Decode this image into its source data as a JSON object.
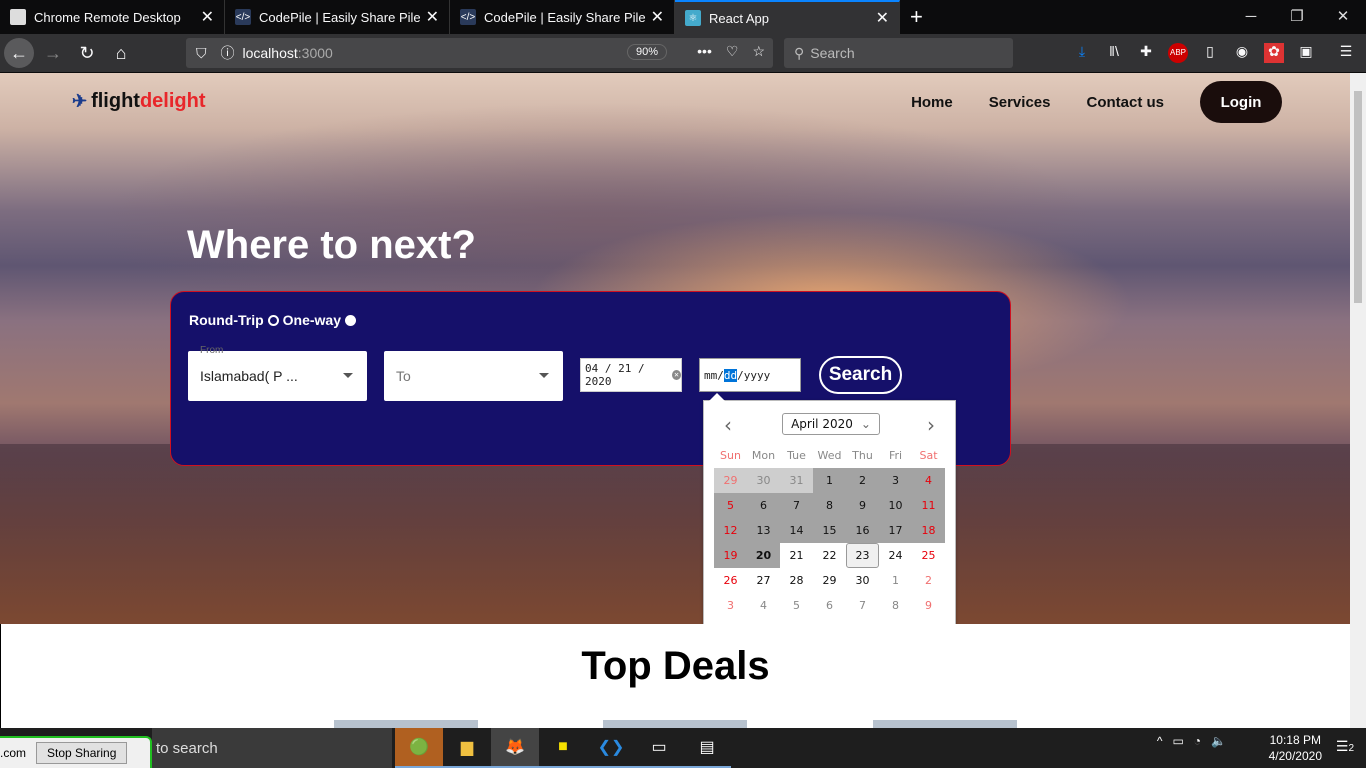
{
  "browser": {
    "tabs": [
      {
        "title": "Chrome Remote Desktop",
        "icon": "remote-desktop-icon"
      },
      {
        "title": "CodePile | Easily Share Piles of Code",
        "icon": "codepile-icon"
      },
      {
        "title": "CodePile | Easily Share Piles of Code",
        "icon": "codepile-icon"
      },
      {
        "title": "React App",
        "icon": "react-icon"
      }
    ],
    "url_host": "localhost",
    "url_port": ":3000",
    "zoom": "90%",
    "search_placeholder": "Search"
  },
  "site": {
    "logo_a": "flight",
    "logo_b": "delight",
    "nav": [
      "Home",
      "Services",
      "Contact us"
    ],
    "login": "Login",
    "headline": "Where to next?",
    "trip_round": "Round-Trip",
    "trip_oneway": "One-way",
    "from_label": "From",
    "from_value": "Islamabad( P  ...",
    "to_placeholder": "To",
    "depart_date": "04 / 21 / 2020",
    "return_mm": "mm",
    "return_dd": "dd",
    "return_yyyy": "yyyy",
    "search": "Search",
    "top_deals": "Top Deals"
  },
  "calendar": {
    "month": "April 2020",
    "dow": [
      "Sun",
      "Mon",
      "Tue",
      "Wed",
      "Thu",
      "Fri",
      "Sat"
    ],
    "weeks": [
      [
        [
          "29",
          "otherpast"
        ],
        [
          "30",
          "otherpast"
        ],
        [
          "31",
          "otherpast"
        ],
        [
          "1",
          "past"
        ],
        [
          "2",
          "past"
        ],
        [
          "3",
          "past"
        ],
        [
          "4",
          "past"
        ]
      ],
      [
        [
          "5",
          "past"
        ],
        [
          "6",
          "past"
        ],
        [
          "7",
          "past"
        ],
        [
          "8",
          "past"
        ],
        [
          "9",
          "past"
        ],
        [
          "10",
          "past"
        ],
        [
          "11",
          "past"
        ]
      ],
      [
        [
          "12",
          "past"
        ],
        [
          "13",
          "past"
        ],
        [
          "14",
          "past"
        ],
        [
          "15",
          "past"
        ],
        [
          "16",
          "past"
        ],
        [
          "17",
          "past"
        ],
        [
          "18",
          "past"
        ]
      ],
      [
        [
          "19",
          "past"
        ],
        [
          "20",
          "past today"
        ],
        [
          "21",
          ""
        ],
        [
          "22",
          ""
        ],
        [
          "23",
          "focus"
        ],
        [
          "24",
          ""
        ],
        [
          "25",
          ""
        ]
      ],
      [
        [
          "26",
          ""
        ],
        [
          "27",
          ""
        ],
        [
          "28",
          ""
        ],
        [
          "29",
          ""
        ],
        [
          "30",
          ""
        ],
        [
          "1",
          "other"
        ],
        [
          "2",
          "other"
        ]
      ],
      [
        [
          "3",
          "other"
        ],
        [
          "4",
          "other"
        ],
        [
          "5",
          "other"
        ],
        [
          "6",
          "other"
        ],
        [
          "7",
          "other"
        ],
        [
          "8",
          "other"
        ],
        [
          "9",
          "other"
        ]
      ]
    ]
  },
  "taskbar": {
    "share_text": ".com",
    "stop_sharing": "Stop Sharing",
    "search": "to search",
    "time": "10:18 PM",
    "date": "4/20/2020",
    "notifications": "2"
  }
}
